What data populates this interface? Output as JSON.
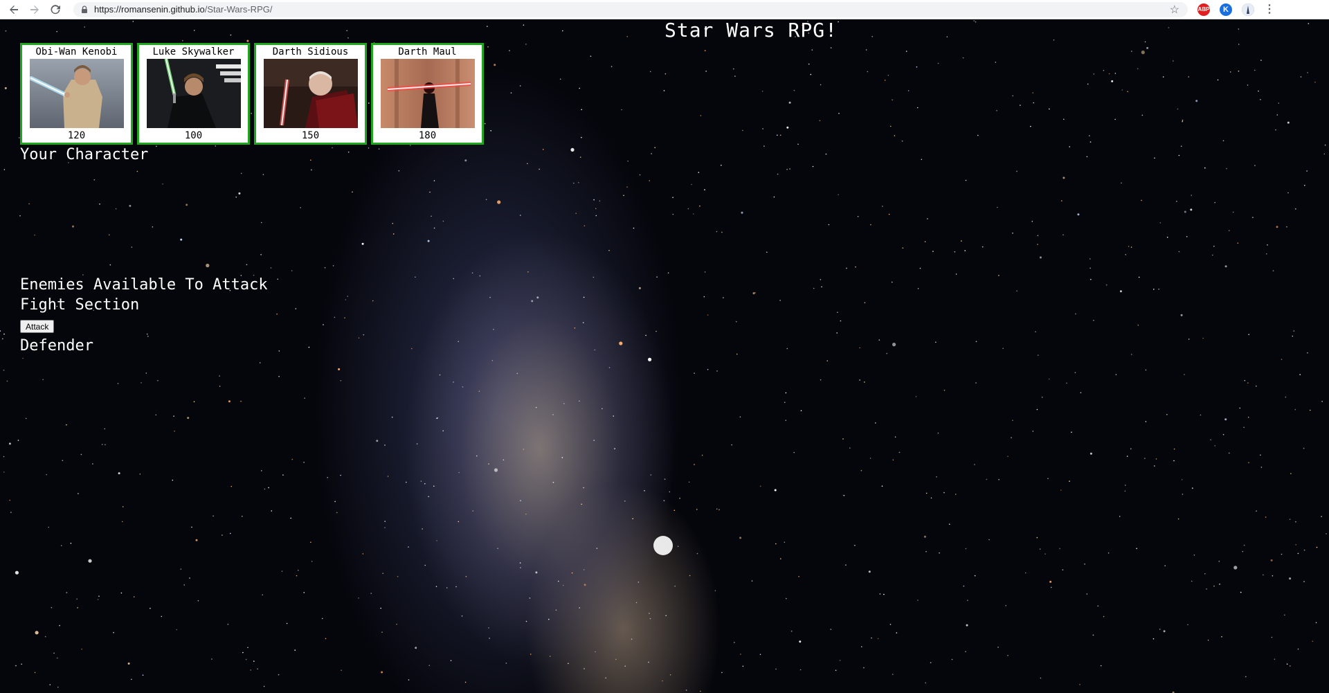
{
  "browser": {
    "url_host": "https://romansenin.github.io",
    "url_path": "/Star-Wars-RPG/",
    "extensions": [
      "ABP",
      "K"
    ]
  },
  "page": {
    "title": "Star Wars RPG!",
    "characters": [
      {
        "name": "Obi-Wan Kenobi",
        "hp": "120",
        "saber_color": "#7fd4ff"
      },
      {
        "name": "Luke Skywalker",
        "hp": "100",
        "saber_color": "#7cff7c"
      },
      {
        "name": "Darth Sidious",
        "hp": "150",
        "saber_color": "#ff2a2a"
      },
      {
        "name": "Darth Maul",
        "hp": "180",
        "saber_color": "#ff2a2a"
      }
    ],
    "your_character_label": "Your Character",
    "enemies_label": "Enemies Available To Attack",
    "fight_label": "Fight Section",
    "attack_button": "Attack",
    "defender_label": "Defender"
  },
  "colors": {
    "card_border": "#1fa81f",
    "background": "#05060c"
  }
}
